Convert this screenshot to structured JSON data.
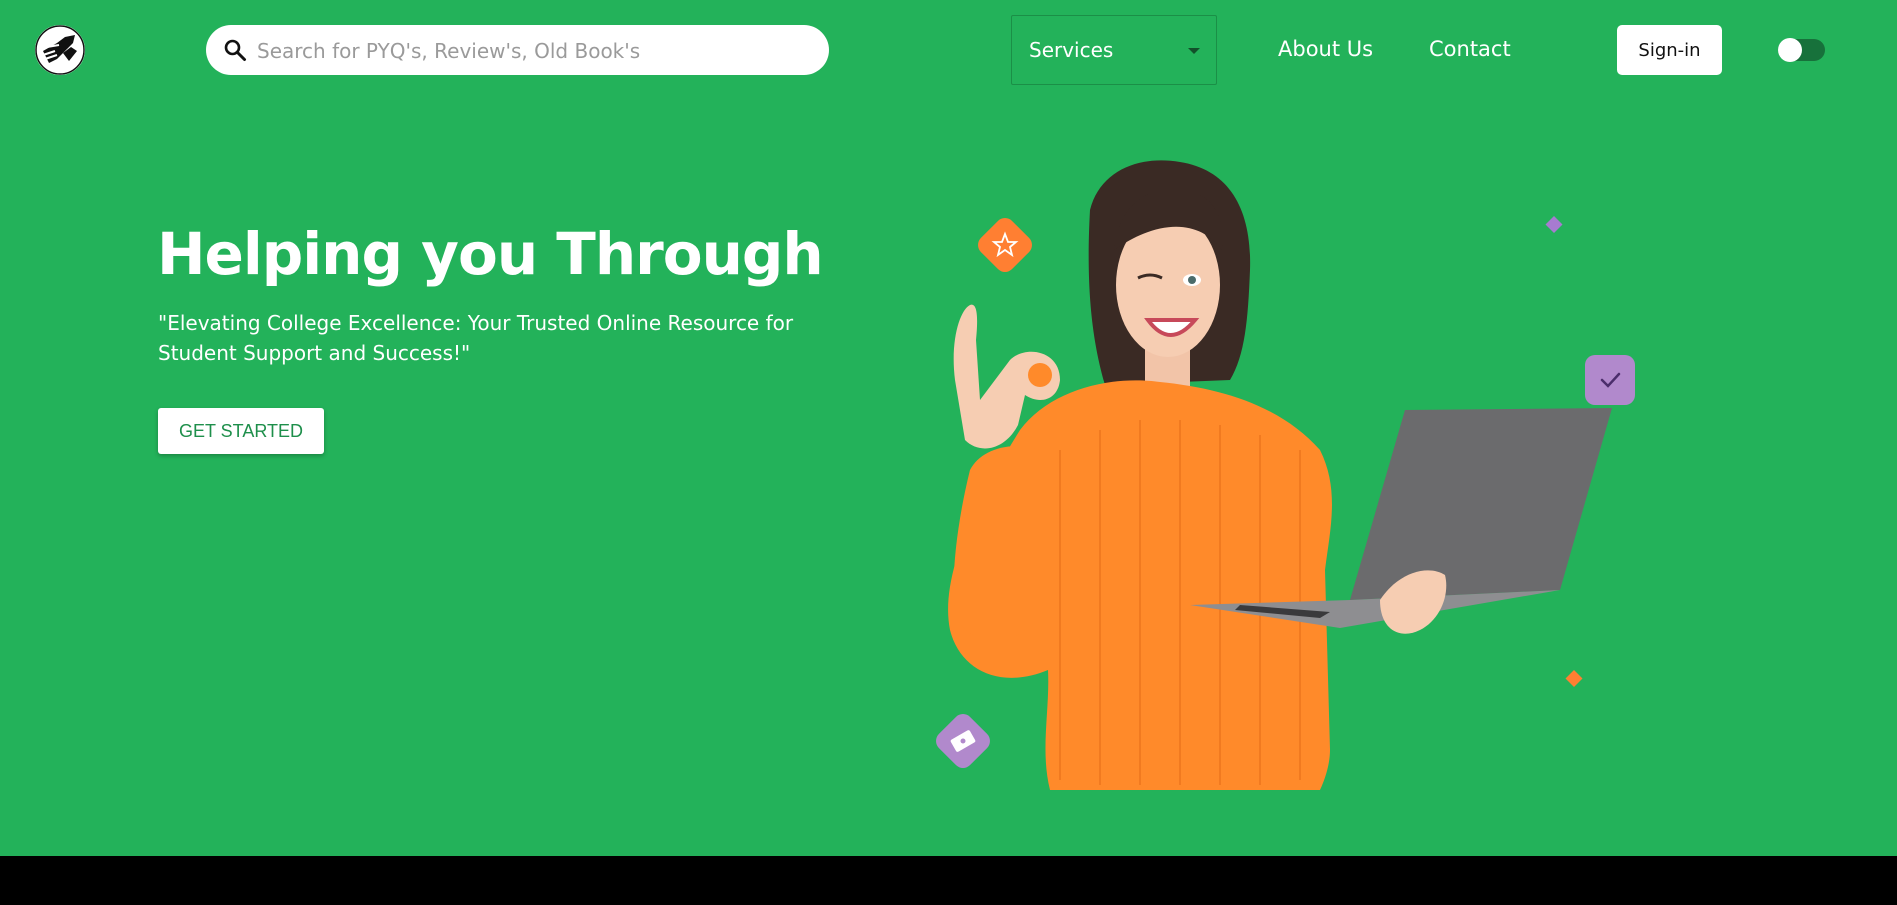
{
  "nav": {
    "search_placeholder": "Search for PYQ's, Review's, Old Book's",
    "services_label": "Services",
    "about_label": "About Us",
    "contact_label": "Contact",
    "signin_label": "Sign-in",
    "dark_mode_toggle_on": false
  },
  "hero": {
    "title": "Helping you Through",
    "subtitle": "\"Elevating College Excellence: Your Trusted Online Resource for Student Support and Success!\"",
    "cta_label": "GET STARTED"
  },
  "colors": {
    "background": "#23b25a",
    "accent_orange": "#ff7f32",
    "accent_purple": "#b189cc",
    "footer": "#000000"
  },
  "icons": [
    "logo-icon",
    "search-icon",
    "chevron-down-icon",
    "star-icon",
    "check-icon",
    "ticket-icon"
  ]
}
